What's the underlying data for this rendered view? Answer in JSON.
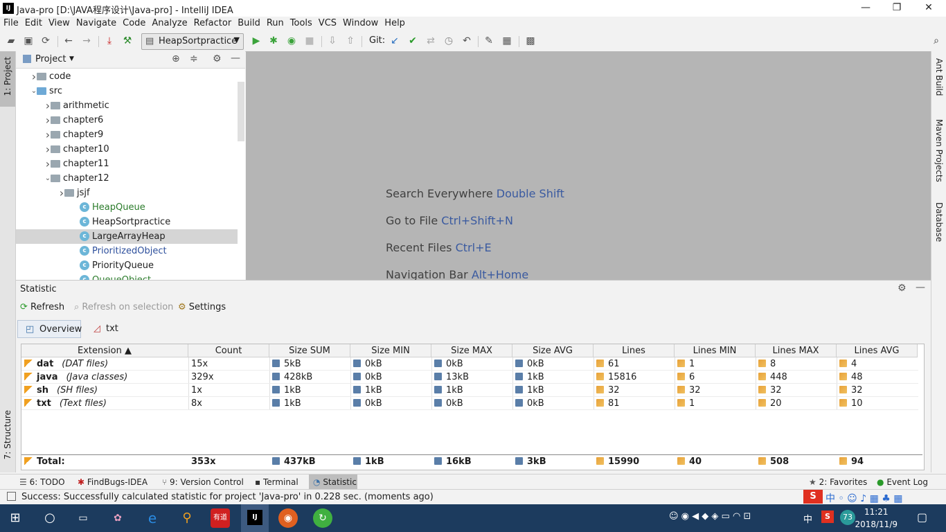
{
  "window": {
    "title": "Java-pro [D:\\JAVA程序设计\\Java-pro] - IntelliJ IDEA",
    "logo_text": "IJ",
    "minimize": "—",
    "restore": "❐",
    "close": "✕"
  },
  "menu": [
    "File",
    "Edit",
    "View",
    "Navigate",
    "Code",
    "Analyze",
    "Refactor",
    "Build",
    "Run",
    "Tools",
    "VCS",
    "Window",
    "Help"
  ],
  "toolbar": {
    "run_config": "HeapSortpractice",
    "git_label": "Git:"
  },
  "left_strip": {
    "project_tab": "1: Project",
    "structure_tab": "7: Structure"
  },
  "right_strip": {
    "ant": "Ant Build",
    "maven": "Maven Projects",
    "database": "Database"
  },
  "project": {
    "header": "Project",
    "tree": [
      {
        "label": "code",
        "depth": 1,
        "kind": "folder",
        "expand": "closed"
      },
      {
        "label": "src",
        "depth": 1,
        "kind": "folder-blue",
        "expand": "open"
      },
      {
        "label": "arithmetic",
        "depth": 2,
        "kind": "folder",
        "expand": "closed"
      },
      {
        "label": "chapter6",
        "depth": 2,
        "kind": "folder",
        "expand": "closed"
      },
      {
        "label": "chapter9",
        "depth": 2,
        "kind": "folder",
        "expand": "closed"
      },
      {
        "label": "chapter10",
        "depth": 2,
        "kind": "folder",
        "expand": "closed"
      },
      {
        "label": "chapter11",
        "depth": 2,
        "kind": "folder",
        "expand": "closed"
      },
      {
        "label": "chapter12",
        "depth": 2,
        "kind": "folder",
        "expand": "open"
      },
      {
        "label": "jsjf",
        "depth": 3,
        "kind": "folder",
        "expand": "closed"
      },
      {
        "label": "HeapQueue",
        "depth": 3,
        "kind": "class",
        "color": "green"
      },
      {
        "label": "HeapSortpractice",
        "depth": 3,
        "kind": "class",
        "color": "default"
      },
      {
        "label": "LargeArrayHeap",
        "depth": 3,
        "kind": "class",
        "color": "default",
        "selected": true
      },
      {
        "label": "PrioritizedObject",
        "depth": 3,
        "kind": "class",
        "color": "blue"
      },
      {
        "label": "PriorityQueue",
        "depth": 3,
        "kind": "class",
        "color": "default"
      },
      {
        "label": "QueueObject",
        "depth": 3,
        "kind": "class",
        "color": "green"
      }
    ]
  },
  "editor_hints": [
    {
      "text": "Search Everywhere",
      "key": "Double Shift"
    },
    {
      "text": "Go to File",
      "key": "Ctrl+Shift+N"
    },
    {
      "text": "Recent Files",
      "key": "Ctrl+E"
    },
    {
      "text": "Navigation Bar",
      "key": "Alt+Home"
    }
  ],
  "statistic": {
    "title": "Statistic",
    "refresh": "Refresh",
    "refresh_on_selection": "Refresh on selection",
    "settings": "Settings",
    "tabs": [
      "Overview",
      "txt"
    ],
    "columns": [
      "Extension ▲",
      "Count",
      "Size SUM",
      "Size MIN",
      "Size MAX",
      "Size AVG",
      "Lines",
      "Lines MIN",
      "Lines MAX",
      "Lines AVG"
    ],
    "rows": [
      {
        "ext": "dat",
        "desc": "(DAT files)",
        "count": "15x",
        "size_sum": "5kB",
        "size_min": "0kB",
        "size_max": "0kB",
        "size_avg": "0kB",
        "lines": "61",
        "lines_min": "1",
        "lines_max": "8",
        "lines_avg": "4"
      },
      {
        "ext": "java",
        "desc": "(Java classes)",
        "count": "329x",
        "size_sum": "428kB",
        "size_min": "0kB",
        "size_max": "13kB",
        "size_avg": "1kB",
        "lines": "15816",
        "lines_min": "6",
        "lines_max": "448",
        "lines_avg": "48"
      },
      {
        "ext": "sh",
        "desc": "(SH files)",
        "count": "1x",
        "size_sum": "1kB",
        "size_min": "1kB",
        "size_max": "1kB",
        "size_avg": "1kB",
        "lines": "32",
        "lines_min": "32",
        "lines_max": "32",
        "lines_avg": "32"
      },
      {
        "ext": "txt",
        "desc": "(Text files)",
        "count": "8x",
        "size_sum": "1kB",
        "size_min": "0kB",
        "size_max": "0kB",
        "size_avg": "0kB",
        "lines": "81",
        "lines_min": "1",
        "lines_max": "20",
        "lines_avg": "10"
      }
    ],
    "total": {
      "label": "Total:",
      "count": "353x",
      "size_sum": "437kB",
      "size_min": "1kB",
      "size_max": "16kB",
      "size_avg": "3kB",
      "lines": "15990",
      "lines_min": "40",
      "lines_max": "508",
      "lines_avg": "94"
    }
  },
  "bottom_tabs": [
    "6: TODO",
    "FindBugs-IDEA",
    "9: Version Control",
    "Terminal",
    "Statistic"
  ],
  "bottom_tabs_right": [
    "2: Favorites",
    "Event Log"
  ],
  "status": "Success: Successfully calculated statistic for project 'Java-pro' in 0.228 sec. (moments ago)",
  "taskbar": {
    "time": "11:21",
    "date": "2018/11/9",
    "ime": "中",
    "badge": "73",
    "youdao": "有道",
    "idea": "IJ"
  }
}
